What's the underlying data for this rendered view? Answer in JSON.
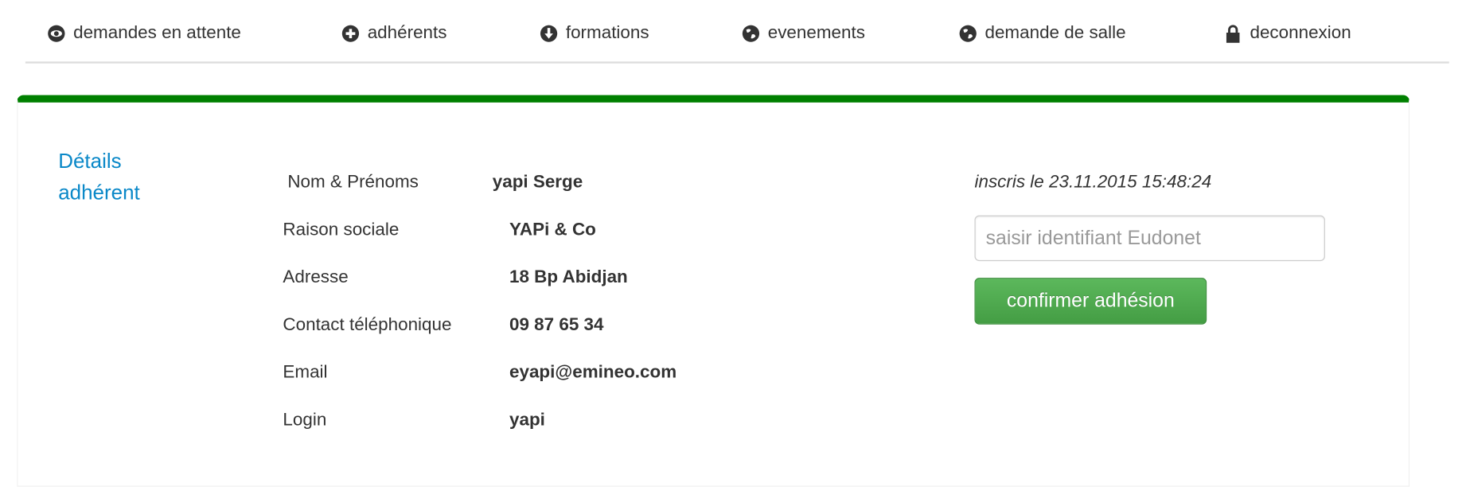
{
  "nav": {
    "items": [
      {
        "label": "demandes en attente",
        "icon": "eye-icon"
      },
      {
        "label": "adhérents",
        "icon": "plus-circle-icon"
      },
      {
        "label": "formations",
        "icon": "arrow-down-circle-icon"
      },
      {
        "label": "evenements",
        "icon": "globe-icon"
      },
      {
        "label": "demande de salle",
        "icon": "globe-icon"
      },
      {
        "label": "deconnexion",
        "icon": "lock-icon"
      }
    ]
  },
  "colors": {
    "accent": "#008000",
    "title": "#0a88c8",
    "button": "#5cb85c"
  },
  "panel": {
    "title": "Détails adhérent",
    "fields": [
      {
        "label": "Nom & Prénoms",
        "value": "yapi Serge"
      },
      {
        "label": "Raison sociale",
        "value": "YAPi & Co"
      },
      {
        "label": "Adresse",
        "value": "18 Bp Abidjan"
      },
      {
        "label": "Contact téléphonique",
        "value": "09 87 65 34"
      },
      {
        "label": "Email",
        "value": "eyapi@emineo.com"
      },
      {
        "label": "Login",
        "value": "yapi"
      }
    ],
    "registered": "inscris le 23.11.2015 15:48:24",
    "eudonet_placeholder": "saisir identifiant Eudonet",
    "eudonet_value": "",
    "confirm_label": "confirmer adhésion"
  }
}
